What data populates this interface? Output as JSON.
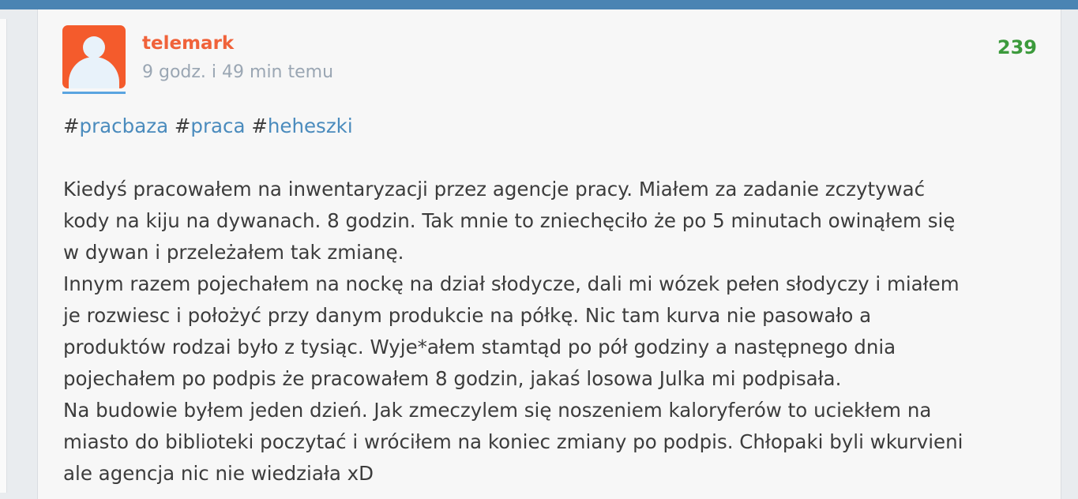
{
  "post": {
    "author": "telemark",
    "time": "9 godz. i 49 min temu",
    "votes": "239",
    "tags": [
      {
        "hash": "#",
        "name": "pracbaza"
      },
      {
        "hash": "#",
        "name": "praca"
      },
      {
        "hash": "#",
        "name": "heheszki"
      }
    ],
    "lines": [
      "Kiedyś pracowałem na inwentaryzacji przez agencje pracy. Miałem za zadanie zczytywać",
      "kody na kiju na dywanach. 8 godzin. Tak mnie to zniechęciło że po 5 minutach owinąłem się",
      "w dywan i przeleżałem tak zmianę.",
      "Innym razem pojechałem na nockę na dział słodycze, dali mi wózek pełen słodyczy i miałem",
      "je rozwiesc i położyć przy danym produkcie na półkę. Nic tam kurva nie pasowało a",
      "produktów rodzai było z tysiąc. Wyje*ałem stamtąd po pół godziny a następnego dnia",
      "pojechałem po podpis że pracowałem 8 godzin, jakaś losowa Julka mi podpisała.",
      "Na budowie byłem jeden dzień. Jak zmeczylem się noszeniem kaloryferów to uciekłem na",
      "miasto do biblioteki poczytać i wróciłem na koniec zmiany po podpis. Chłopaki byli wkurvieni",
      "ale agencja nic nie wiedziała xD"
    ]
  }
}
